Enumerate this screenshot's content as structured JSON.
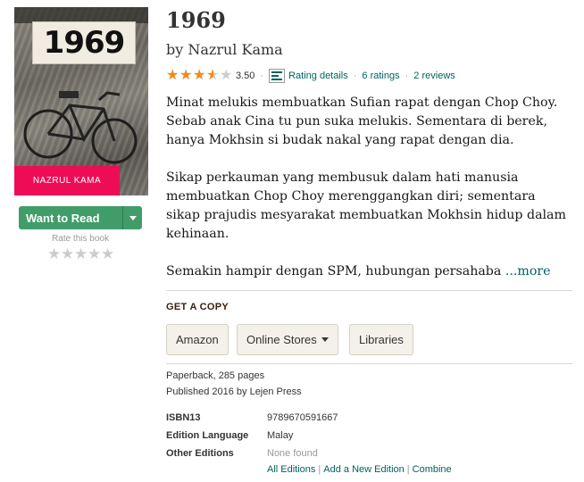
{
  "cover": {
    "title_text": "1969",
    "author_text": "NAZRUL KAMA"
  },
  "shelf": {
    "want_label": "Want to Read",
    "rate_label": "Rate this book"
  },
  "book": {
    "title": "1969",
    "byline": "by Nazrul Kama",
    "rating": {
      "average": "3.50",
      "stars_value": 3.5,
      "details_label": "Rating details",
      "ratings_count": "6 ratings",
      "reviews_count": "2 reviews"
    },
    "description": [
      "Minat melukis membuatkan Sufian rapat dengan Chop Choy. Sebab anak Cina tu pun suka melukis. Sementara di berek, hanya Mokhsin si budak nakal yang rapat dengan dia.",
      "Sikap perkauman yang membusuk dalam hati manusia membuatkan Chop Choy merenggangkan diri; sementara sikap prajudis mesyarakat membuatkan Mokhsin hidup dalam kehinaan.",
      "Semakin hampir dengan SPM, hubungan persahaba"
    ],
    "more_label": "...more"
  },
  "get_copy": {
    "heading": "GET A COPY",
    "buttons": [
      "Amazon",
      "Online Stores",
      "Libraries"
    ]
  },
  "details": {
    "format": "Paperback, 285 pages",
    "published": "Published 2016 by Lejen Press",
    "isbn_label": "ISBN13",
    "isbn_value": "9789670591667",
    "language_label": "Edition Language",
    "language_value": "Malay",
    "editions_label": "Other Editions",
    "editions_value": "None found",
    "links": [
      "All Editions",
      "Add a New Edition",
      "Combine"
    ]
  },
  "colors": {
    "accent_green": "#409d69",
    "link_teal": "#00635d",
    "star_orange": "#f38a1b",
    "cover_band": "#ee0c57"
  }
}
